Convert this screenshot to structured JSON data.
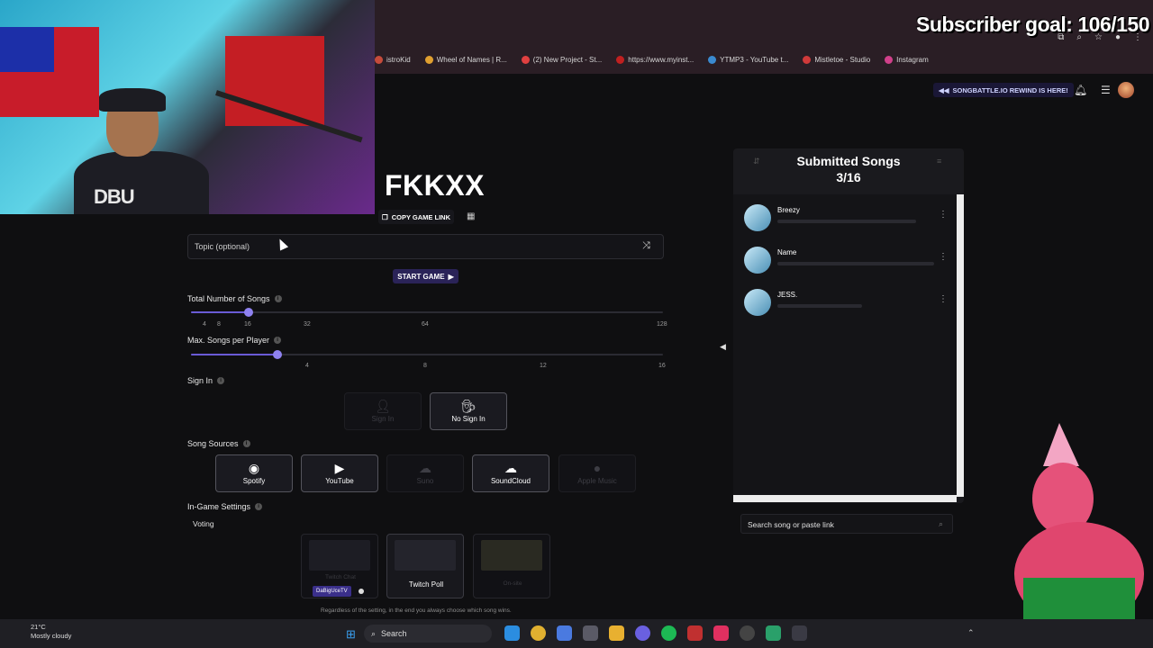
{
  "overlay": {
    "subscriber_goal": "Subscriber goal: 106/150"
  },
  "bookmarks": [
    {
      "label": "istroKid",
      "color": "#c54b3b"
    },
    {
      "label": "Wheel of Names | R...",
      "color": "#e0a030"
    },
    {
      "label": "(2) New Project - St...",
      "color": "#e04040"
    },
    {
      "label": "https://www.myinst...",
      "color": "#c02020"
    },
    {
      "label": "YTMP3 - YouTube t...",
      "color": "#3a8ad0"
    },
    {
      "label": "Mistletoe - Studio",
      "color": "#d03a3a"
    },
    {
      "label": "Instagram",
      "color": "#d0408a"
    }
  ],
  "header": {
    "rewind_label": "SONGBATTLE.IO REWIND IS HERE!"
  },
  "game": {
    "title": "FKKXX",
    "copy_link_label": "COPY GAME LINK",
    "topic_placeholder": "Topic (optional)",
    "start_label": "START GAME"
  },
  "settings": {
    "total_songs_label": "Total Number of Songs",
    "total_songs_ticks": [
      "4",
      "8",
      "16",
      "32",
      "64",
      "128"
    ],
    "total_songs_value": 16,
    "max_songs_label": "Max. Songs per Player",
    "max_songs_ticks": [
      "4",
      "8",
      "12",
      "16"
    ],
    "max_songs_value": 2,
    "sign_in_label": "Sign In",
    "sign_in_options": [
      "Sign In",
      "No Sign In"
    ],
    "sign_in_selected": "No Sign In",
    "song_sources_label": "Song Sources",
    "sources": [
      {
        "label": "Spotify",
        "enabled": true
      },
      {
        "label": "YouTube",
        "enabled": true
      },
      {
        "label": "Suno",
        "enabled": false
      },
      {
        "label": "SoundCloud",
        "enabled": true
      },
      {
        "label": "Apple Music",
        "enabled": false
      }
    ],
    "in_game_label": "In-Game Settings",
    "voting_label": "Voting",
    "voting_options": [
      "Twitch Chat",
      "Twitch Poll",
      "On-site"
    ],
    "twitch_tag": "DaBigUceTV",
    "voting_note": "Regardless of the setting, in the end you always choose which song wins."
  },
  "submitted": {
    "title": "Submitted Songs",
    "count": "3/16",
    "songs": [
      {
        "name": "Breezy"
      },
      {
        "name": "Name"
      },
      {
        "name": "JESS."
      }
    ],
    "search_placeholder": "Search song or paste link"
  },
  "taskbar": {
    "temperature": "21°C",
    "weather": "Mostly cloudy",
    "search_label": "Search"
  },
  "colors": {
    "accent": "#6a5bd6",
    "start_bg": "#2a2358",
    "background": "#0f0f11"
  }
}
